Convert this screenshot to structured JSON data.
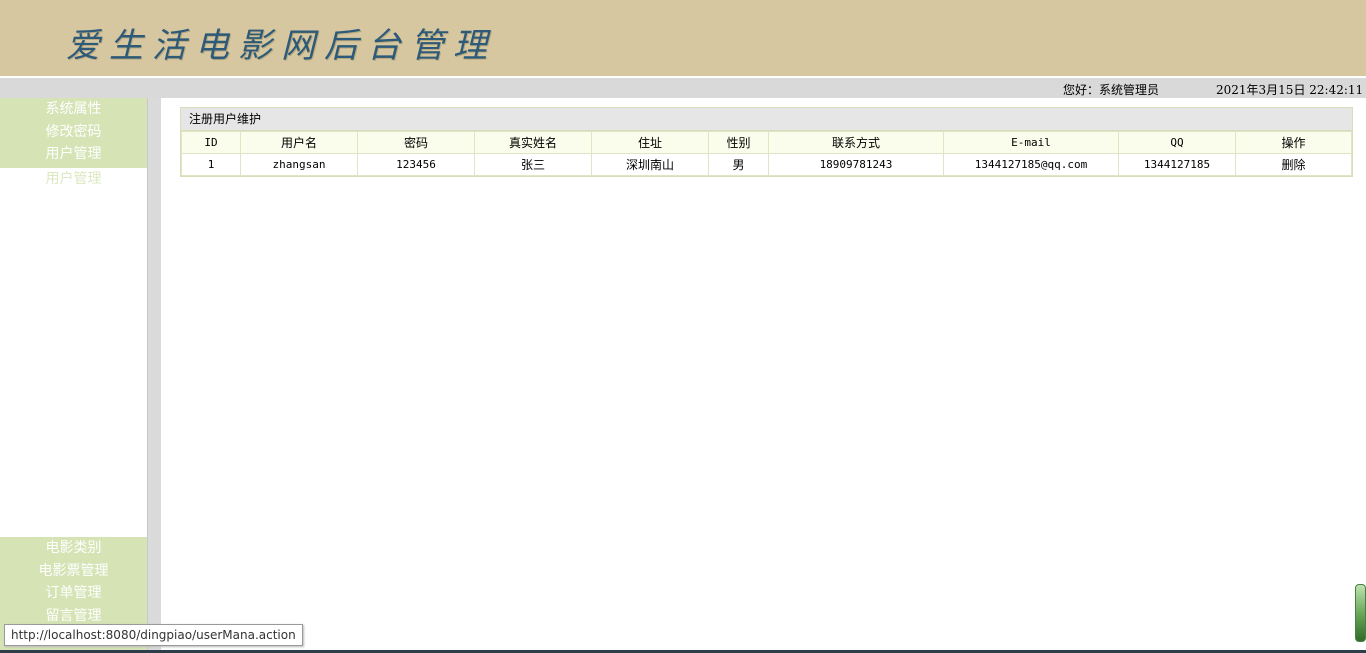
{
  "header": {
    "title": "爱生活电影网后台管理",
    "greeting": "您好：系统管理员",
    "datetime": "2021年3月15日 22:42:11"
  },
  "sidebar": {
    "top_items": [
      {
        "label": "系统属性"
      },
      {
        "label": "修改密码"
      },
      {
        "label": "用户管理"
      }
    ],
    "sub_item": {
      "label": "用户管理"
    },
    "bottom_items": [
      {
        "label": "电影类别"
      },
      {
        "label": "电影票管理"
      },
      {
        "label": "订单管理"
      },
      {
        "label": "留言管理"
      }
    ]
  },
  "main": {
    "panel_title": "注册用户维护",
    "columns": [
      "ID",
      "用户名",
      "密码",
      "真实姓名",
      "住址",
      "性别",
      "联系方式",
      "E-mail",
      "QQ",
      "操作"
    ],
    "rows": [
      {
        "id": "1",
        "username": "zhangsan",
        "password": "123456",
        "realname": "张三",
        "address": "深圳南山",
        "gender": "男",
        "phone": "18909781243",
        "email": "1344127185@qq.com",
        "qq": "1344127185",
        "action": "删除"
      }
    ]
  },
  "statusbar": {
    "url": "http://localhost:8080/dingpiao/userMana.action"
  },
  "colors": {
    "banner": "#d6c7a1",
    "title": "#2c5a78",
    "menu_bg": "#d5e3b5",
    "header_row": "#fafcec"
  }
}
